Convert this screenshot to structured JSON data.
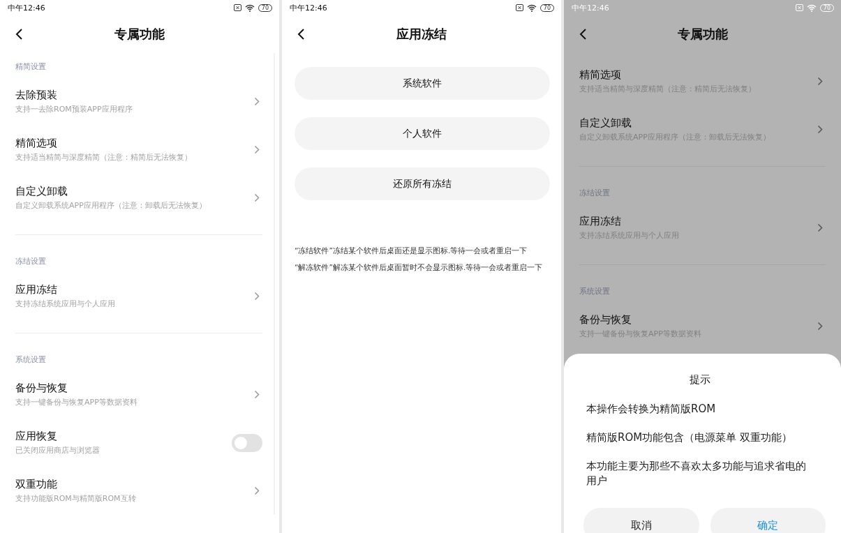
{
  "screens": [
    {
      "kind": "settings",
      "dimmed": false,
      "status_bar": {
        "time": "中午12:46",
        "battery": "70"
      },
      "title": "专属功能",
      "sections": [
        {
          "heading": "精简设置",
          "items": [
            {
              "kind": "link",
              "title": "去除预装",
              "subtitle": "支持一去除ROM预装APP应用程序"
            },
            {
              "kind": "link",
              "title": "精简选项",
              "subtitle": "支持适当精简与深度精简（注意：精简后无法恢复）"
            },
            {
              "kind": "link",
              "title": "自定义卸载",
              "subtitle": "自定义卸载系统APP应用程序（注意：卸载后无法恢复）"
            }
          ]
        },
        {
          "heading": "冻结设置",
          "items": [
            {
              "kind": "link",
              "title": "应用冻结",
              "subtitle": "支持冻结系统应用与个人应用"
            }
          ]
        },
        {
          "heading": "系统设置",
          "items": [
            {
              "kind": "link",
              "title": "备份与恢复",
              "subtitle": "支持一键备份与恢复APP等数据资料"
            },
            {
              "kind": "toggle",
              "title": "应用恢复",
              "subtitle": "已关闭应用商店与浏览器",
              "on": false
            },
            {
              "kind": "link",
              "title": "双重功能",
              "subtitle": "支持功能版ROM与精简版ROM互转"
            }
          ]
        }
      ]
    },
    {
      "kind": "buttons",
      "status_bar": {
        "time": "中午12:46",
        "battery": "70"
      },
      "title": "应用冻结",
      "buttons": [
        "系统软件",
        "个人软件",
        "还原所有冻结"
      ],
      "notes": [
        "“冻结软件”冻结某个软件后桌面还是显示图标.等待一会或者重启一下",
        "“解冻软件”解冻某个软件后桌面暂时不会显示图标.等待一会或者重启一下"
      ]
    },
    {
      "kind": "settings",
      "dimmed": true,
      "status_bar": {
        "time": "中午12:46",
        "battery": "70"
      },
      "title": "专属功能",
      "sections": [
        {
          "items": [
            {
              "kind": "link",
              "title": "精简选项",
              "subtitle": "支持适当精简与深度精简（注意：精简后无法恢复）"
            },
            {
              "kind": "link",
              "title": "自定义卸载",
              "subtitle": "自定义卸载系统APP应用程序（注意：卸载后无法恢复）"
            }
          ]
        },
        {
          "heading": "冻结设置",
          "items": [
            {
              "kind": "link",
              "title": "应用冻结",
              "subtitle": "支持冻结系统应用与个人应用"
            }
          ]
        },
        {
          "heading": "系统设置",
          "items": [
            {
              "kind": "link",
              "title": "备份与恢复",
              "subtitle": "支持一键备份与恢复APP等数据资料"
            }
          ]
        }
      ],
      "dialog": {
        "title": "提示",
        "lines": [
          "本操作会转换为精简版ROM",
          "精简版ROM功能包含（电源菜单 双重功能）",
          "本功能主要为那些不喜欢太多功能与追求省电的用户"
        ],
        "buttons": [
          {
            "label": "取消",
            "primary": false
          },
          {
            "label": "确定",
            "primary": true
          }
        ]
      }
    }
  ]
}
